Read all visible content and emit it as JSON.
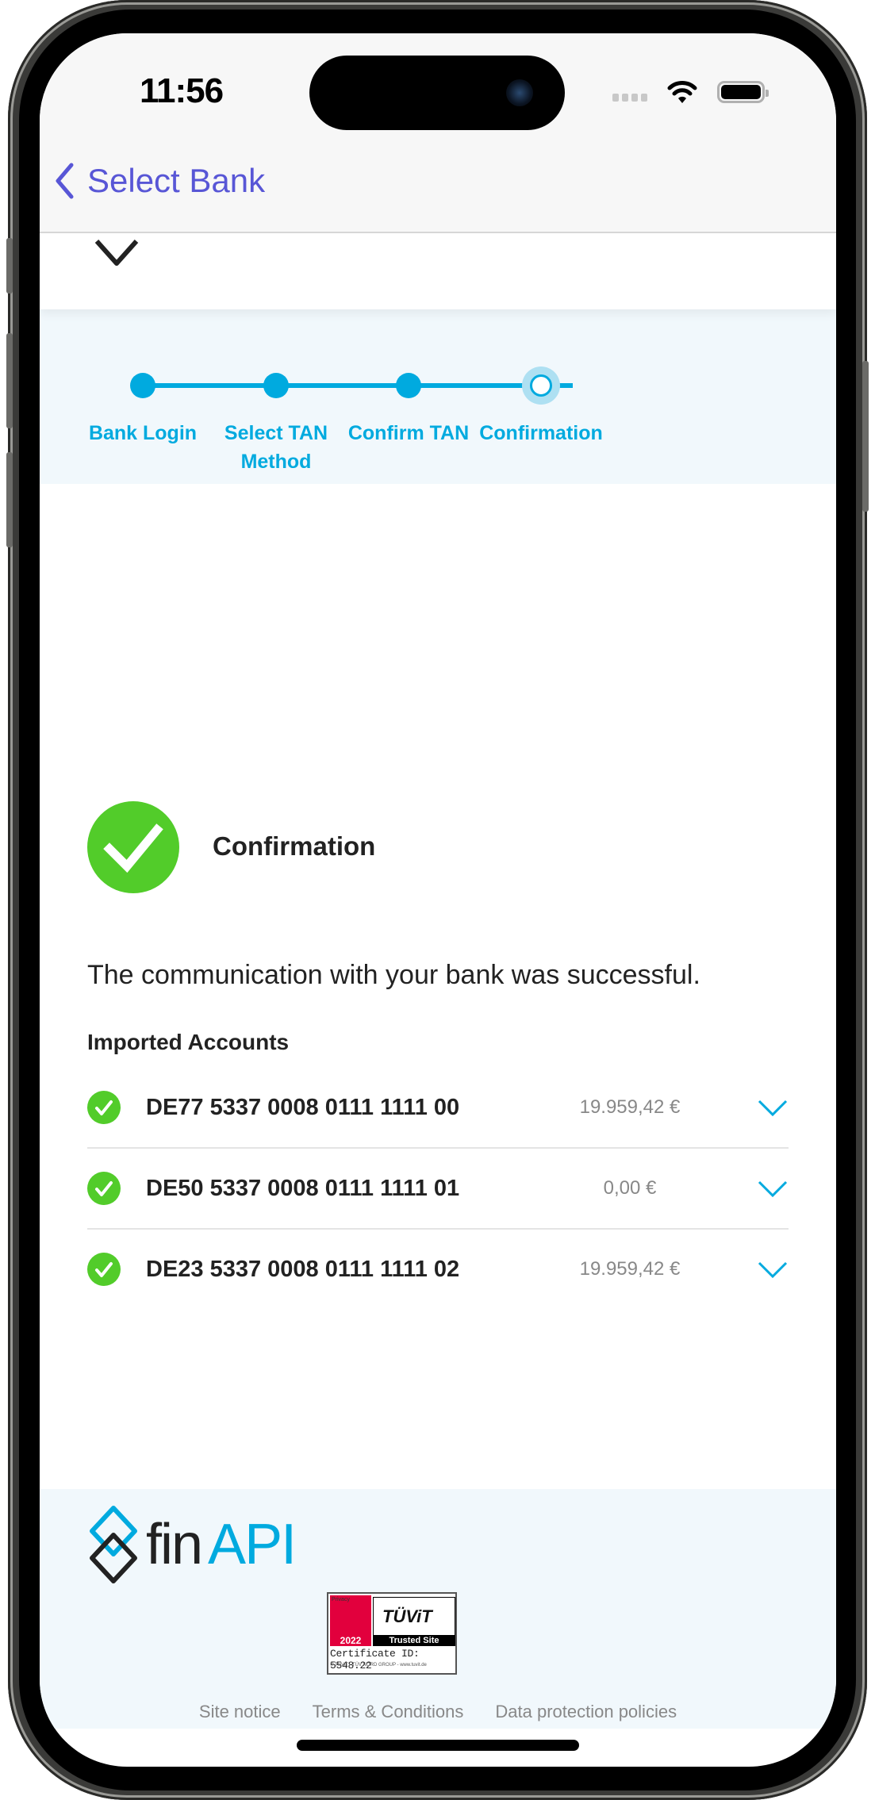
{
  "status_bar": {
    "time": "11:56"
  },
  "nav": {
    "back_label": "Select Bank"
  },
  "stepper": {
    "steps": [
      {
        "label": "Bank Login",
        "state": "done"
      },
      {
        "label": "Select TAN Method",
        "state": "done"
      },
      {
        "label": "Confirm TAN",
        "state": "done"
      },
      {
        "label": "Confirmation",
        "state": "current"
      }
    ]
  },
  "confirmation": {
    "title": "Confirmation",
    "message": "The communication with your bank was successful.",
    "imported_heading": "Imported Accounts",
    "accounts": [
      {
        "iban": "DE77 5337 0008 0111 1111 00",
        "balance": "19.959,42 €"
      },
      {
        "iban": "DE50 5337 0008 0111 1111 01",
        "balance": "0,00 €"
      },
      {
        "iban": "DE23 5337 0008 0111 1111 02",
        "balance": "19.959,42 €"
      }
    ],
    "close_label": "Close"
  },
  "footer": {
    "logo_fin": "fin",
    "logo_api": "API",
    "badge": {
      "privacy": "Privacy",
      "brand": "TÜViT",
      "year": "2022",
      "trusted": "Trusted Site",
      "certificate": "Certificate ID: 5548.22",
      "copyright": "© TÜViT - TÜV NORD GROUP - www.tuvit.de"
    },
    "links": [
      "Site notice",
      "Terms & Conditions",
      "Data protection policies"
    ]
  },
  "colors": {
    "accent": "#00aadf",
    "success": "#52cc2a",
    "nav_tint": "#5856d6"
  }
}
